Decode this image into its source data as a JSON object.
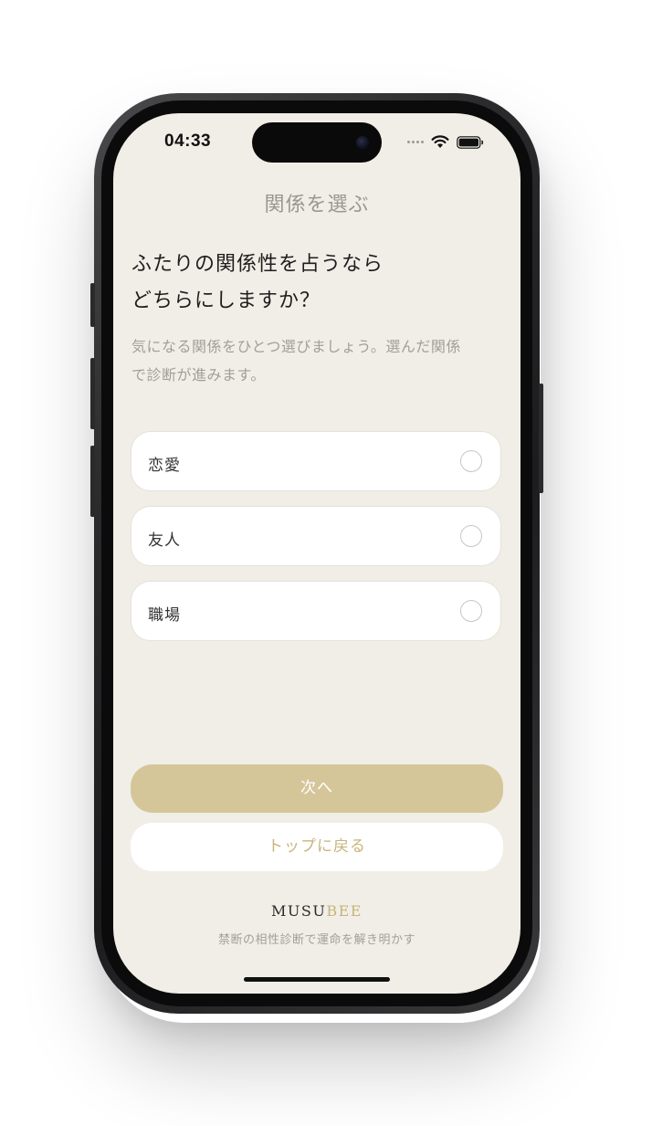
{
  "status_bar": {
    "time": "04:33"
  },
  "header": {
    "title": "関係を選ぶ"
  },
  "question": {
    "line1": "ふたりの関係性を占うなら",
    "line2": "どちらにしますか？"
  },
  "description": {
    "line1": "気になる関係をひとつ選びましょう。選んだ関係",
    "line2": "で診断が進みます。"
  },
  "options": [
    {
      "label": "恋愛",
      "selected": false
    },
    {
      "label": "友人",
      "selected": false
    },
    {
      "label": "職場",
      "selected": false
    }
  ],
  "actions": {
    "next_label": "次へ",
    "back_to_top_label": "トップに戻る"
  },
  "footer": {
    "brand_part1": "MUSU",
    "brand_part2": "BEE",
    "tagline": "禁断の相性診断で運命を解き明かす"
  },
  "colors": {
    "background": "#f1eee7",
    "accent_gold": "#d5c69a",
    "accent_gold_text": "#c8b47a",
    "muted_text": "#a29e98"
  },
  "icons": {
    "wifi": "wifi-icon",
    "battery": "battery-icon",
    "cellular": "cellular-signal-icon",
    "radio": "radio-unchecked-icon"
  }
}
